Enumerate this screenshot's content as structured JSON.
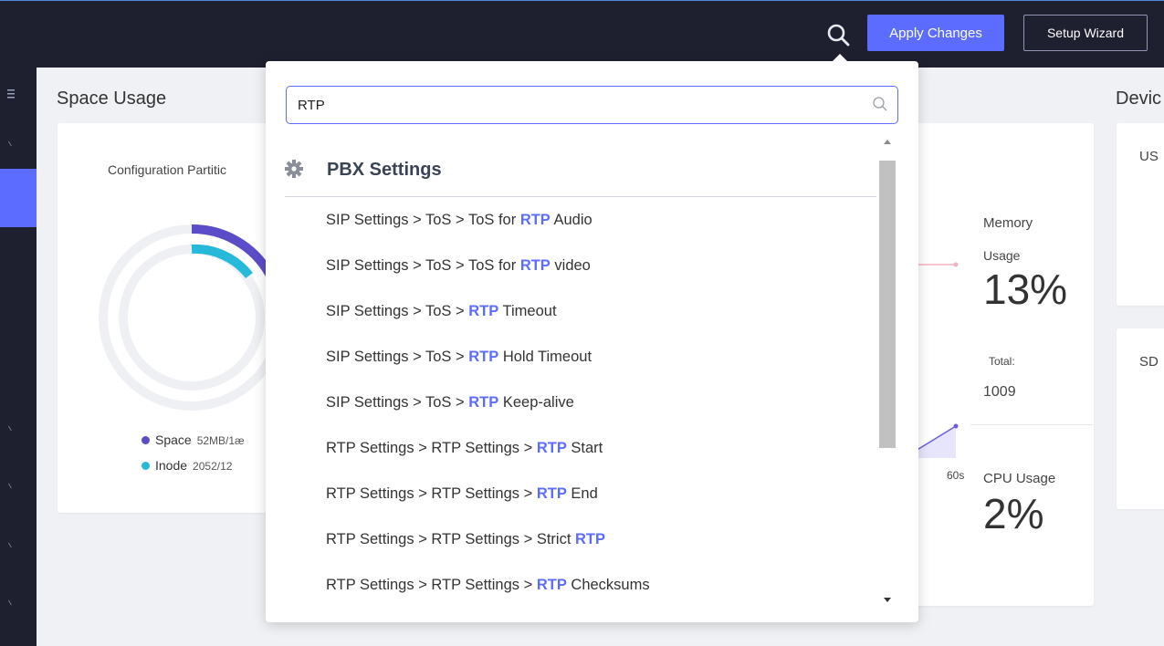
{
  "header": {
    "search_icon": "search-icon",
    "apply_label": "Apply Changes",
    "wizard_label": "Setup Wizard"
  },
  "sidebar": {
    "menu_icon": "menu-icon"
  },
  "space_usage": {
    "title": "Space Usage",
    "partition_label": "Configuration Partitic",
    "legend": [
      {
        "label": "Space",
        "value": "52MB/1æ",
        "color": "#5b4cc8"
      },
      {
        "label": "Inode",
        "value": "2052/12",
        "color": "#27b9d9"
      }
    ]
  },
  "memory": {
    "label": "Memory",
    "usage_label": "Usage",
    "usage_value": "13%",
    "total_label": "Total:",
    "total_value": "1009",
    "axis_label": "60s"
  },
  "cpu": {
    "label": "CPU Usage",
    "value": "2%"
  },
  "device": {
    "title": "Devic",
    "card1": "US",
    "card2": "SD"
  },
  "search": {
    "value": "RTP",
    "group_title": "PBX Settings",
    "results": [
      {
        "prefix": "SIP Settings > ToS > ToS for ",
        "match": "RTP",
        "suffix": " Audio"
      },
      {
        "prefix": "SIP Settings > ToS > ToS for ",
        "match": "RTP",
        "suffix": " video"
      },
      {
        "prefix": "SIP Settings > ToS > ",
        "match": "RTP",
        "suffix": " Timeout"
      },
      {
        "prefix": "SIP Settings > ToS > ",
        "match": "RTP",
        "suffix": " Hold Timeout"
      },
      {
        "prefix": "SIP Settings > ToS > ",
        "match": "RTP",
        "suffix": " Keep-alive"
      },
      {
        "prefix": "RTP Settings > RTP Settings > ",
        "match": "RTP",
        "suffix": " Start"
      },
      {
        "prefix": "RTP Settings > RTP Settings > ",
        "match": "RTP",
        "suffix": " End"
      },
      {
        "prefix": "RTP Settings > RTP Settings > Strict ",
        "match": "RTP",
        "suffix": ""
      },
      {
        "prefix": "RTP Settings > RTP Settings > ",
        "match": "RTP",
        "suffix": " Checksums"
      }
    ]
  },
  "colors": {
    "accent": "#5b6cff",
    "topbar": "#1e1f2f",
    "background": "#f0f1f5"
  }
}
